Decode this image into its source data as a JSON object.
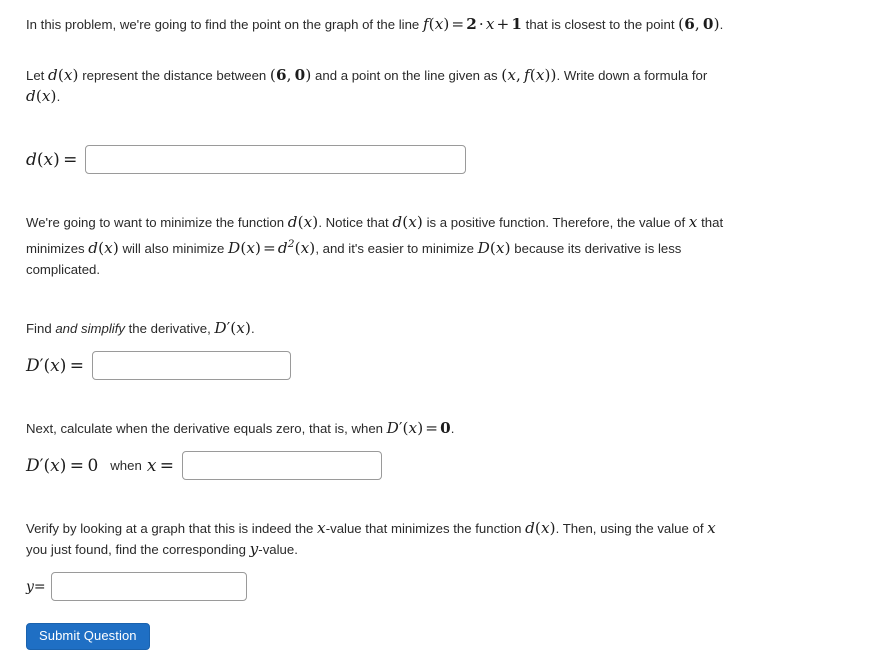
{
  "problem": {
    "intro": {
      "text_before_math": "In this problem, we're going to find the point on the graph of the line ",
      "math_function": "f(x) = 2 · x + 1",
      "text_after_math": " that is closest to the point ",
      "math_point": "(6, 0)",
      "text_end": "."
    },
    "distance_paragraph": {
      "s1": "Let ",
      "m1": "d(x)",
      "s2": " represent the distance between ",
      "m2": "(6, 0)",
      "s3": " and a point on the line given as ",
      "m3": "(x, f(x))",
      "s4": ". Write down a formula for ",
      "m4": "d(x)",
      "s5": "."
    },
    "answer_dx": {
      "label": "d(x) =",
      "value": "",
      "placeholder": ""
    },
    "minimize_paragraph": {
      "s1": "We're going to want to minimize the function ",
      "m1": "d(x)",
      "s2": ". Notice that ",
      "m2": "d(x)",
      "s3": " is a positive function. Therefore, the value of ",
      "m3": "x",
      "s4": " that minimizes ",
      "m4": "d(x)",
      "s5": " will also minimize ",
      "m5": "D(x) = d²(x)",
      "s6": ", and it's easier to minimize ",
      "m6": "D(x)",
      "s7": " because its derivative is less complicated."
    },
    "derivative_prompt": {
      "s1": "Find ",
      "emphasis": "and simplify",
      "s2": " the derivative, ",
      "m1": "D'(x)",
      "s3": "."
    },
    "answer_dprime": {
      "label": "D'(x) =",
      "value": "",
      "placeholder": ""
    },
    "zero_prompt": {
      "s1": "Next, calculate when the derivative equals zero, that is, when ",
      "m1": "D'(x) = 0",
      "s2": "."
    },
    "answer_x": {
      "label": "D'(x) = 0",
      "connector": "when",
      "variable": "x",
      "equals": "=",
      "value": "",
      "placeholder": ""
    },
    "verify_paragraph": {
      "s1": "Verify by looking at a graph that this is indeed the ",
      "m1": "x",
      "s2": "-value that minimizes the function ",
      "m2": "d(x)",
      "s3": ". Then, using the value of ",
      "m3": "x",
      "s4": " you just found, find the corresponding ",
      "m4": "y",
      "s5": "-value."
    },
    "answer_y": {
      "label": "y=",
      "value": "",
      "placeholder": ""
    },
    "submit": {
      "label": "Submit Question"
    }
  },
  "colors": {
    "submit_button_background": "#1f6fc4",
    "submit_button_text": "#ffffff",
    "input_border": "#9a9a9a",
    "body_text": "#2a2a2a",
    "page_background": "#ffffff"
  }
}
